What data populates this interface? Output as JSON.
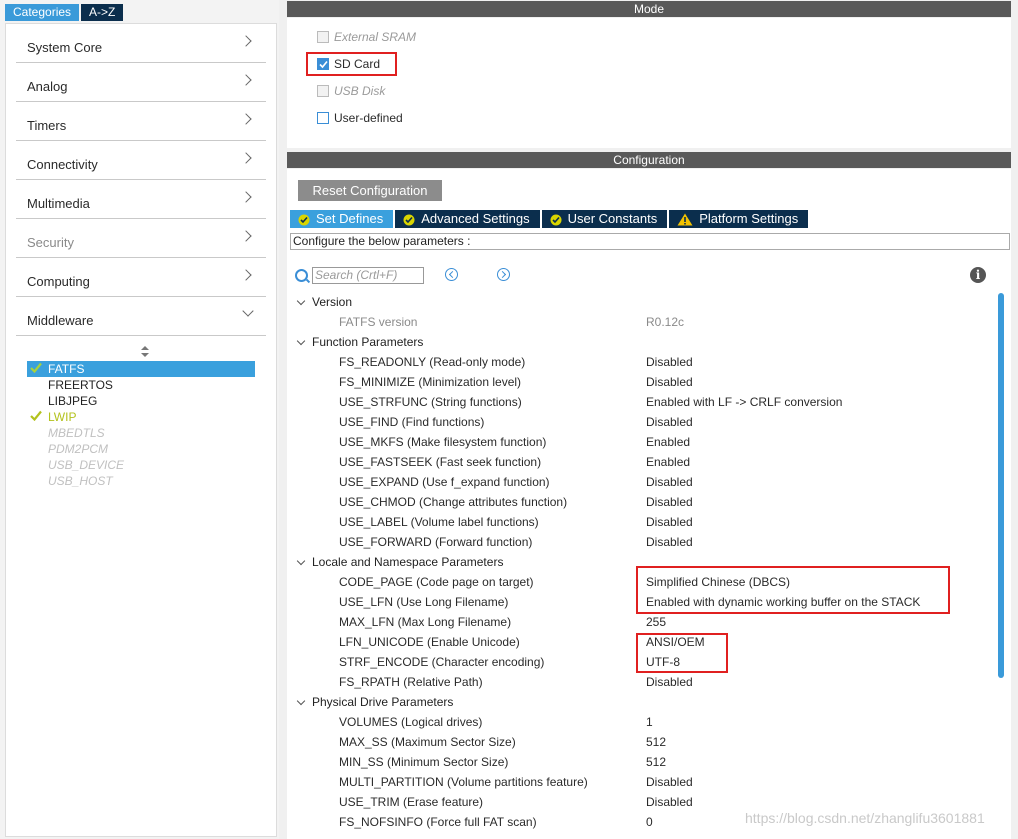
{
  "left_panel": {
    "tabs": {
      "categories": "Categories",
      "az": "A->Z"
    },
    "categories": [
      {
        "label": "System Core"
      },
      {
        "label": "Analog"
      },
      {
        "label": "Timers"
      },
      {
        "label": "Connectivity"
      },
      {
        "label": "Multimedia"
      },
      {
        "label": "Security"
      },
      {
        "label": "Computing"
      },
      {
        "label": "Middleware"
      }
    ],
    "middleware_items": [
      {
        "label": "FATFS",
        "state": "selected-checked"
      },
      {
        "label": "FREERTOS",
        "state": "normal"
      },
      {
        "label": "LIBJPEG",
        "state": "normal"
      },
      {
        "label": "LWIP",
        "state": "checked"
      },
      {
        "label": "MBEDTLS",
        "state": "disabled"
      },
      {
        "label": "PDM2PCM",
        "state": "disabled"
      },
      {
        "label": "USB_DEVICE",
        "state": "disabled"
      },
      {
        "label": "USB_HOST",
        "state": "disabled"
      }
    ]
  },
  "mode": {
    "title": "Mode",
    "options": [
      {
        "label": "External SRAM",
        "checked": false,
        "enabled": false
      },
      {
        "label": "SD Card",
        "checked": true,
        "enabled": true
      },
      {
        "label": "USB Disk",
        "checked": false,
        "enabled": false
      },
      {
        "label": "User-defined",
        "checked": false,
        "enabled": true
      }
    ]
  },
  "configuration": {
    "title": "Configuration",
    "reset_button": "Reset Configuration",
    "tabs": [
      {
        "label": "Set Defines",
        "icon": "check-circle-icon",
        "active": true
      },
      {
        "label": "Advanced Settings",
        "icon": "check-circle-icon",
        "active": false
      },
      {
        "label": "User Constants",
        "icon": "check-circle-icon",
        "active": false
      },
      {
        "label": "Platform Settings",
        "icon": "warning-triangle-icon",
        "active": false
      }
    ],
    "configure_text": "Configure the below parameters :",
    "search_placeholder": "Search (Crtl+F)",
    "groups": [
      {
        "label": "Version",
        "params": [
          {
            "name": "FATFS version",
            "value": "R0.12c",
            "dim": true
          }
        ]
      },
      {
        "label": "Function Parameters",
        "params": [
          {
            "name": "FS_READONLY (Read-only mode)",
            "value": "Disabled"
          },
          {
            "name": "FS_MINIMIZE (Minimization level)",
            "value": "Disabled"
          },
          {
            "name": "USE_STRFUNC (String functions)",
            "value": "Enabled with LF -> CRLF conversion"
          },
          {
            "name": "USE_FIND (Find functions)",
            "value": "Disabled"
          },
          {
            "name": "USE_MKFS (Make filesystem function)",
            "value": "Enabled"
          },
          {
            "name": "USE_FASTSEEK (Fast seek function)",
            "value": "Enabled"
          },
          {
            "name": "USE_EXPAND (Use f_expand function)",
            "value": "Disabled"
          },
          {
            "name": "USE_CHMOD (Change attributes function)",
            "value": "Disabled"
          },
          {
            "name": "USE_LABEL (Volume label functions)",
            "value": "Disabled"
          },
          {
            "name": "USE_FORWARD (Forward function)",
            "value": "Disabled"
          }
        ]
      },
      {
        "label": "Locale and Namespace Parameters",
        "params": [
          {
            "name": "CODE_PAGE (Code page on target)",
            "value": "Simplified Chinese (DBCS)"
          },
          {
            "name": "USE_LFN (Use Long Filename)",
            "value": "Enabled with dynamic working buffer on the STACK"
          },
          {
            "name": "MAX_LFN (Max Long Filename)",
            "value": "255"
          },
          {
            "name": "LFN_UNICODE (Enable Unicode)",
            "value": "ANSI/OEM"
          },
          {
            "name": "STRF_ENCODE (Character encoding)",
            "value": "UTF-8"
          },
          {
            "name": "FS_RPATH (Relative Path)",
            "value": "Disabled"
          }
        ]
      },
      {
        "label": "Physical Drive Parameters",
        "params": [
          {
            "name": "VOLUMES (Logical drives)",
            "value": "1"
          },
          {
            "name": "MAX_SS (Maximum Sector Size)",
            "value": "512"
          },
          {
            "name": "MIN_SS (Minimum Sector Size)",
            "value": "512"
          },
          {
            "name": "MULTI_PARTITION (Volume partitions feature)",
            "value": "Disabled"
          },
          {
            "name": "USE_TRIM (Erase feature)",
            "value": "Disabled"
          },
          {
            "name": "FS_NOFSINFO (Force full FAT scan)",
            "value": "0"
          }
        ]
      }
    ]
  },
  "watermark": "https://blog.csdn.net/zhanglifu3601881",
  "colors": {
    "accent_blue": "#3a9ad9",
    "dark_navy": "#0b2e4d",
    "header_gray": "#595959",
    "annotation_red": "#e02020",
    "lwip_check": "#b3c21d"
  }
}
